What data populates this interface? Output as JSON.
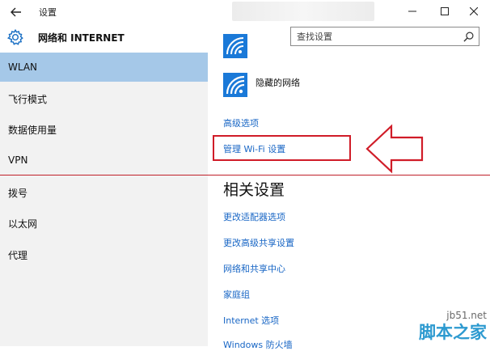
{
  "window": {
    "title": "设置"
  },
  "header": {
    "section_title": "网络和 INTERNET",
    "search_placeholder": "查找设置"
  },
  "sidebar": {
    "items": [
      {
        "label": "WLAN",
        "active": true
      },
      {
        "label": "飞行模式",
        "active": false
      },
      {
        "label": "数据使用量",
        "active": false
      },
      {
        "label": "VPN",
        "active": false
      },
      {
        "label": "拨号",
        "active": false
      },
      {
        "label": "以太网",
        "active": false
      },
      {
        "label": "代理",
        "active": false
      }
    ]
  },
  "main": {
    "hidden_network": "隐藏的网络",
    "advanced_options": "高级选项",
    "manage_wifi": "管理 Wi-Fi 设置",
    "related_title": "相关设置",
    "related_links": [
      "更改适配器选项",
      "更改高级共享设置",
      "网络和共享中心",
      "家庭组",
      "Internet 选项",
      "Windows 防火墙"
    ]
  },
  "watermark": {
    "url": "jb51.net",
    "name": "脚本之家"
  },
  "colors": {
    "accent": "#1a79d8",
    "link": "#1866c5",
    "sidebar_active": "#a5c8e8",
    "annotation": "#d01c28"
  },
  "icons": {
    "back": "arrow-left-icon",
    "settings": "gear-icon",
    "search": "search-icon",
    "wifi": "wifi-icon"
  }
}
